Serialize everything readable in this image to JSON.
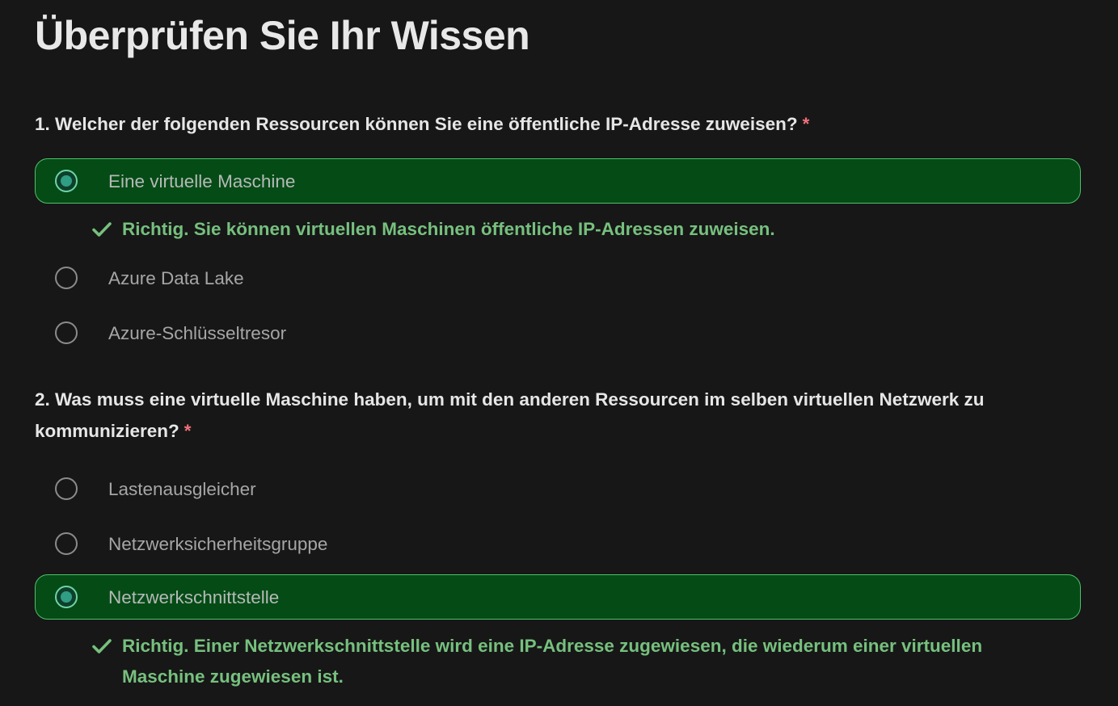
{
  "page": {
    "title": "Überprüfen Sie Ihr Wissen"
  },
  "colors": {
    "background": "#171717",
    "selected_background": "#054b16",
    "selected_border": "#50c06a",
    "correct_text": "#76c07e",
    "required_asterisk": "#f1707b"
  },
  "questions": [
    {
      "text": "1. Welcher der folgenden Ressourcen können Sie eine öffentliche IP-Adresse zuweisen?",
      "required_marker": "*",
      "options": [
        {
          "label": "Eine virtuelle Maschine",
          "selected": true
        },
        {
          "label": "Azure Data Lake",
          "selected": false
        },
        {
          "label": "Azure-Schlüsseltresor",
          "selected": false
        }
      ],
      "feedback": {
        "icon": "checkmark-icon",
        "text": "Richtig. Sie können virtuellen Maschinen öffentliche IP-Adressen zuweisen."
      }
    },
    {
      "text": "2. Was muss eine virtuelle Maschine haben, um mit den anderen Ressourcen im selben virtuellen Netzwerk zu kommunizieren?",
      "required_marker": "*",
      "options": [
        {
          "label": "Lastenausgleicher",
          "selected": false
        },
        {
          "label": "Netzwerksicherheitsgruppe",
          "selected": false
        },
        {
          "label": "Netzwerkschnittstelle",
          "selected": true
        }
      ],
      "feedback": {
        "icon": "checkmark-icon",
        "text": "Richtig. Einer Netzwerkschnittstelle wird eine IP-Adresse zugewiesen, die wiederum einer virtuellen Maschine zugewiesen ist."
      }
    }
  ]
}
